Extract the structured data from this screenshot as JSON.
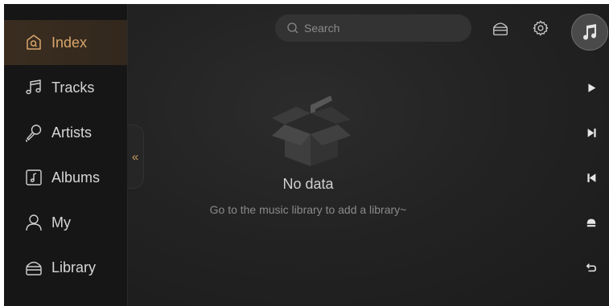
{
  "sidebar": {
    "items": [
      {
        "label": "Index",
        "icon": "index-icon",
        "active": true
      },
      {
        "label": "Tracks",
        "icon": "tracks-icon",
        "active": false
      },
      {
        "label": "Artists",
        "icon": "artists-icon",
        "active": false
      },
      {
        "label": "Albums",
        "icon": "albums-icon",
        "active": false
      },
      {
        "label": "My",
        "icon": "user-icon",
        "active": false
      },
      {
        "label": "Library",
        "icon": "library-icon",
        "active": false
      }
    ],
    "collapse_glyph": "«"
  },
  "search": {
    "placeholder": "Search"
  },
  "header": {
    "icons": [
      "library-icon",
      "gear-icon",
      "music-note-icon"
    ]
  },
  "empty_state": {
    "title": "No data",
    "subtitle": "Go to the music library to add a library~"
  },
  "controls": [
    "play-icon",
    "next-icon",
    "previous-icon",
    "eject-icon",
    "back-icon"
  ],
  "colors": {
    "accent": "#d8a66b",
    "active_bg": "#3a2d20",
    "background": "#1f1f1f",
    "sidebar_bg": "#161616"
  }
}
